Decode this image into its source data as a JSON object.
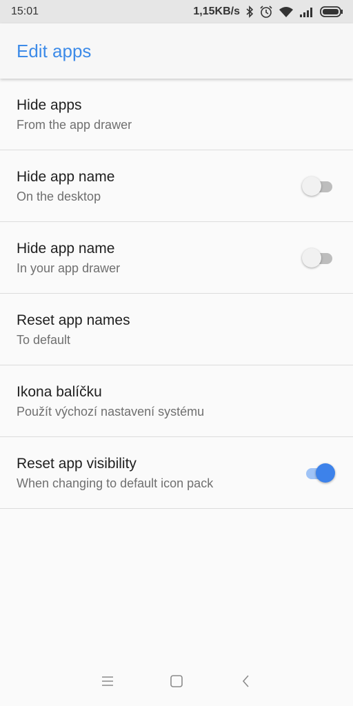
{
  "status_bar": {
    "time": "15:01",
    "speed": "1,15KB/s",
    "icons": [
      "bluetooth-icon",
      "alarm-icon",
      "wifi-icon",
      "signal-icon",
      "battery-icon"
    ]
  },
  "app_bar": {
    "title": "Edit apps",
    "accent_color": "#3d8be8"
  },
  "settings": [
    {
      "title": "Hide apps",
      "subtitle": "From the app drawer",
      "toggle": null
    },
    {
      "title": "Hide app name",
      "subtitle": "On the desktop",
      "toggle": false
    },
    {
      "title": "Hide app name",
      "subtitle": "In your app drawer",
      "toggle": false
    },
    {
      "title": "Reset app names",
      "subtitle": "To default",
      "toggle": null
    },
    {
      "title": "Ikona balíčku",
      "subtitle": "Použít výchozí nastavení systému",
      "toggle": null
    },
    {
      "title": "Reset app visibility",
      "subtitle": "When changing to default icon pack",
      "toggle": true
    }
  ],
  "nav_bar": {
    "icons": [
      "menu-icon",
      "home-icon",
      "back-icon"
    ]
  }
}
